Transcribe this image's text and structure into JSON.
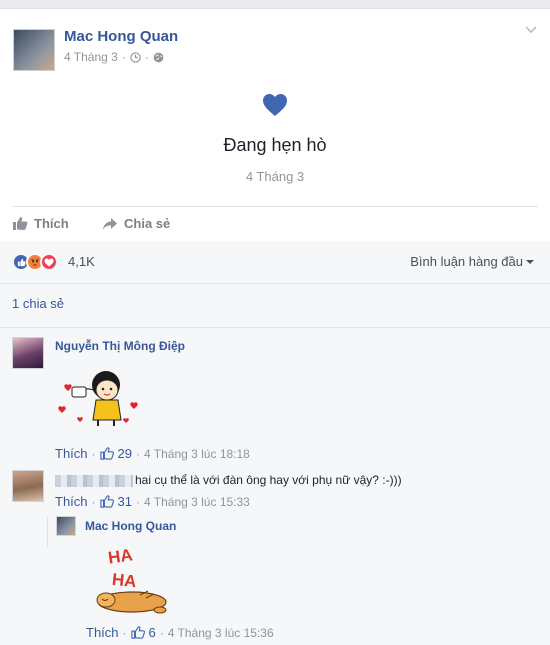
{
  "post": {
    "author": "Mac Hong Quan",
    "date": "4 Tháng 3",
    "dot": "·",
    "life_event": {
      "title": "Đang hẹn hò",
      "date": "4 Tháng 3"
    }
  },
  "actions": {
    "like": "Thích",
    "share": "Chia sẻ"
  },
  "reactions": {
    "count": "4,1K",
    "icons": [
      "like-icon",
      "angry-icon",
      "love-icon"
    ],
    "sort_label": "Bình luận hàng đầu"
  },
  "shares": "1 chia sẻ",
  "comments": [
    {
      "name": "Nguyễn Thị Mông Điệp",
      "sticker": "hearts-girl-sticker",
      "like": "Thích",
      "dot": "·",
      "count": "29",
      "time": "4 Tháng 3 lúc 18:18"
    },
    {
      "name": "",
      "text": "hai cụ thể là với đàn ông hay với phụ nữ vậy? :-)))",
      "like": "Thích",
      "dot": "·",
      "count": "31",
      "time": "4 Tháng 3 lúc 15:33",
      "reply": {
        "name": "Mac Hong Quan",
        "sticker": "haha-dog-sticker",
        "sticker_text": [
          "HA",
          "HA"
        ],
        "like": "Thích",
        "dot": "·",
        "count": "6",
        "time": "4 Tháng 3 lúc 15:36"
      }
    }
  ],
  "colors": {
    "link": "#365899",
    "muted": "#90949c",
    "heart": "#4267b2",
    "panel": "#f6f7f9"
  }
}
